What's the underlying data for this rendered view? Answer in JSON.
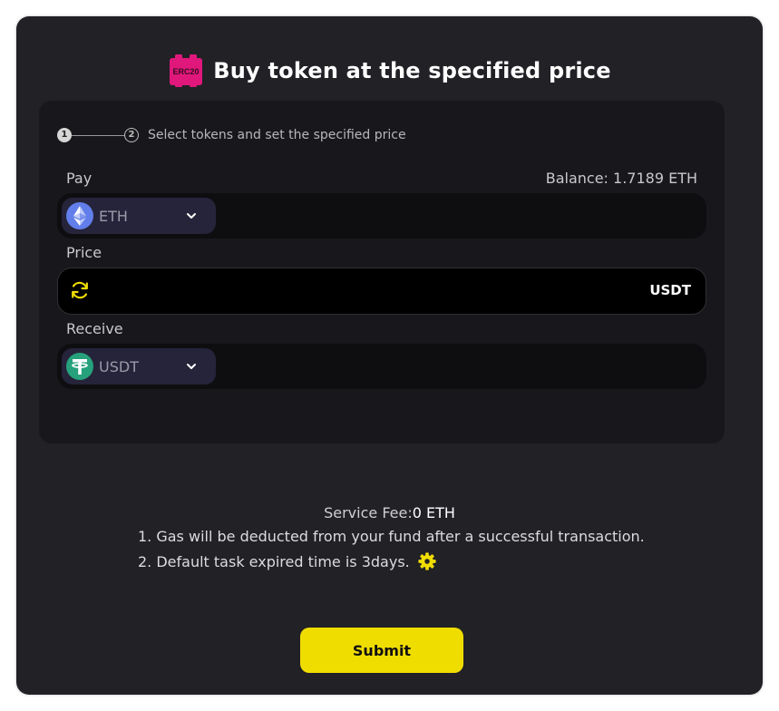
{
  "header": {
    "logo_text": "ERC20",
    "title": "Buy token at the specified price"
  },
  "steps": {
    "step1": "1",
    "step2": "2",
    "description": "Select tokens and set the specified price"
  },
  "pay": {
    "label": "Pay",
    "balance": "Balance: 1.7189 ETH",
    "token": "ETH",
    "token_icon": "ethereum-icon",
    "amount": ""
  },
  "price": {
    "label": "Price",
    "value": "",
    "unit": "USDT",
    "icon": "refresh-icon"
  },
  "receive": {
    "label": "Receive",
    "token": "USDT",
    "token_icon": "tether-icon",
    "amount": ""
  },
  "info": {
    "fee_label": "Service Fee:",
    "fee_value": "0 ETH",
    "note1": "1. Gas will be deducted from your fund after a successful transaction.",
    "note2": "2. Default task expired time is 3days."
  },
  "submit_label": "Submit",
  "colors": {
    "accent": "#f0dd00",
    "brand_pink": "#e0187c",
    "card_bg": "#222126",
    "panel_bg": "#18181c",
    "eth_blue": "#627eea",
    "usdt_green": "#26a17b"
  }
}
